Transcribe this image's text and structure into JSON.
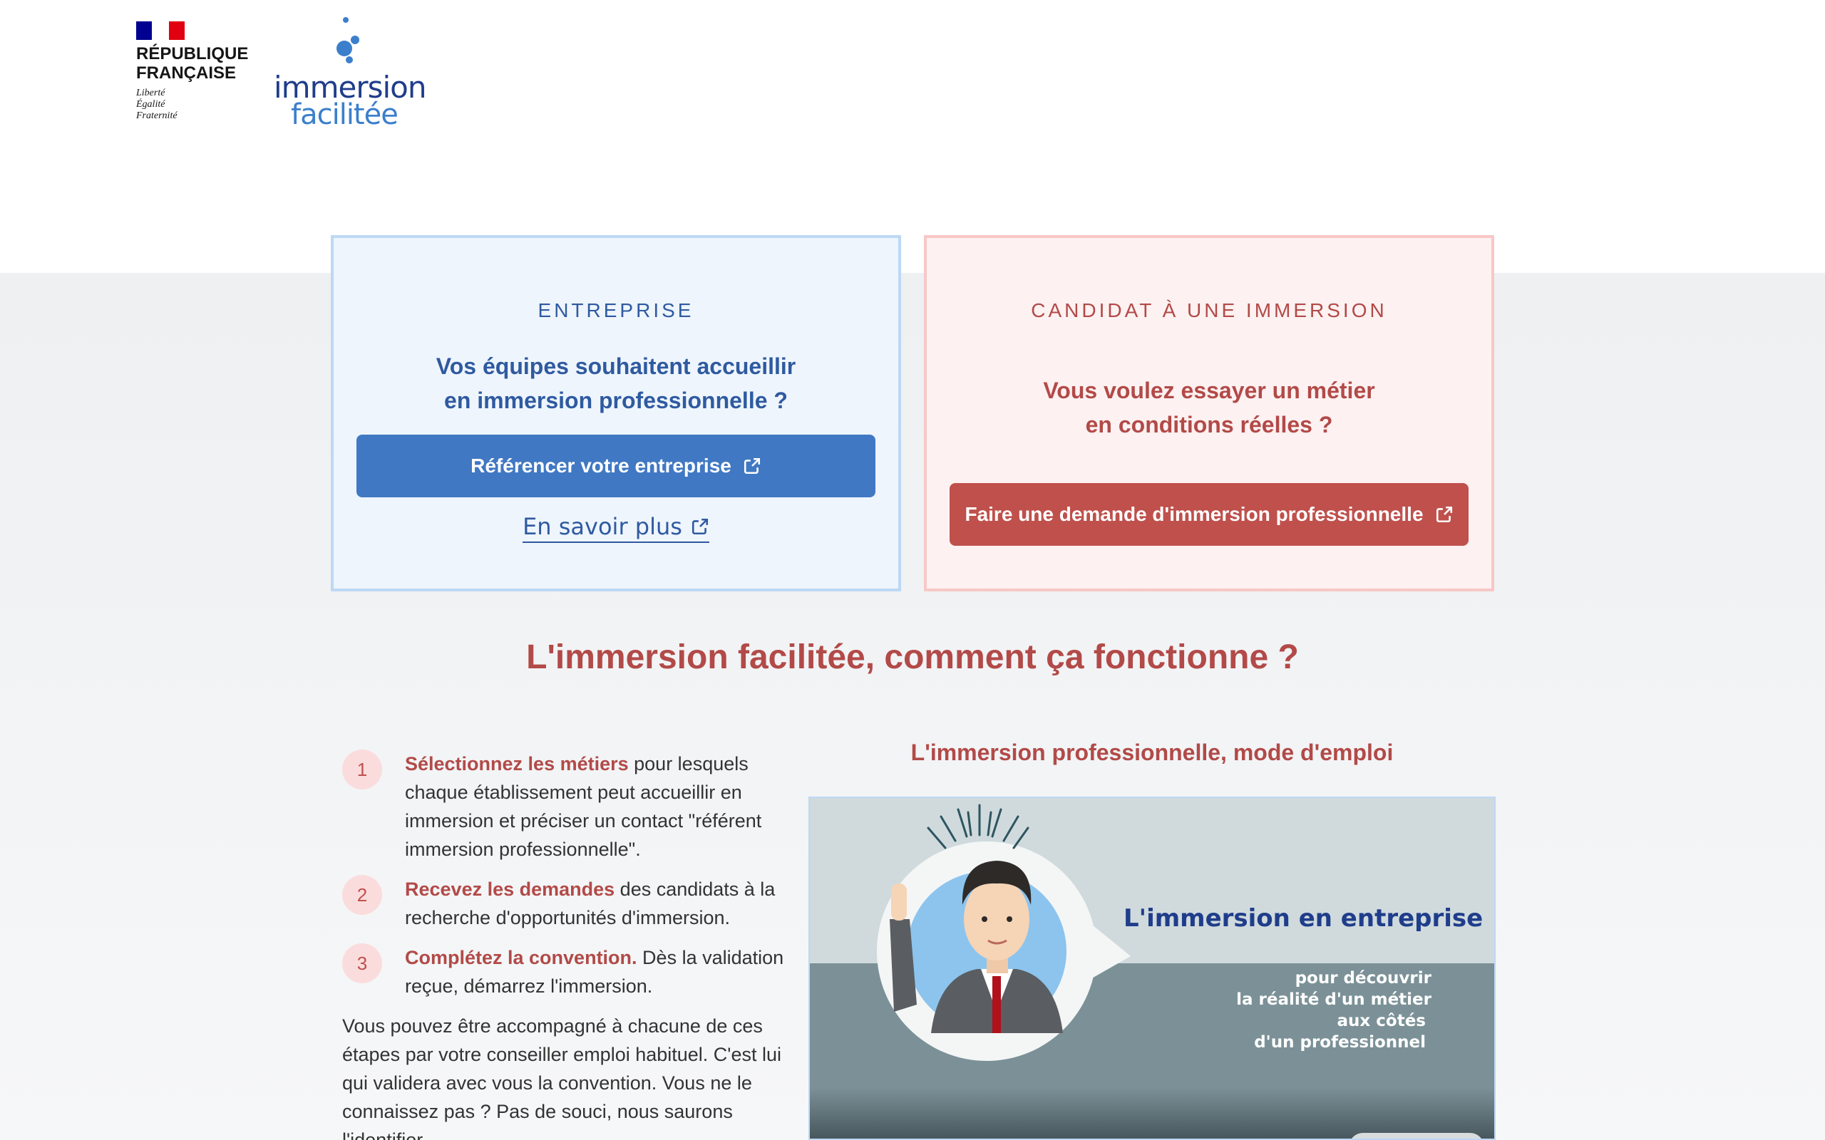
{
  "header": {
    "gov_line1": "RÉPUBLIQUE",
    "gov_line2": "FRANÇAISE",
    "motto1": "Liberté",
    "motto2": "Égalité",
    "motto3": "Fraternité",
    "logo_line1": "immersion",
    "logo_line2": "facilitée"
  },
  "cards": {
    "entreprise": {
      "kicker": "ENTREPRISE",
      "question_line1": "Vos équipes souhaitent accueillir",
      "question_line2": "en immersion professionnelle ?",
      "button": "Référencer votre entreprise",
      "link": "En savoir plus"
    },
    "candidat": {
      "kicker": "CANDIDAT À UNE IMMERSION",
      "question_line1": "Vous voulez essayer un métier",
      "question_line2": "en conditions réelles ?",
      "button": "Faire une demande d'immersion professionnelle"
    }
  },
  "how": {
    "title": "L'immersion facilitée, comment ça fonctionne ?",
    "steps": [
      {
        "num": "1",
        "bold": "Sélectionnez les métiers",
        "text": " pour lesquels chaque établissement peut accueillir en immersion et préciser un contact \"référent immersion professionnelle\"."
      },
      {
        "num": "2",
        "bold": "Recevez les demandes",
        "text": " des candidats à la recherche d'opportunités d'immersion."
      },
      {
        "num": "3",
        "bold": "Complétez la convention.",
        "text": " Dès la validation reçue, démarrez l'immersion."
      }
    ],
    "paragraph": "Vous pouvez être accompagné à chacune de ces étapes par votre conseiller emploi habituel. C'est lui qui validera avec vous la convention. Vous ne le connaissez pas ? Pas de souci, nous saurons l'identifier."
  },
  "video": {
    "title": "L'immersion professionnelle, mode d'emploi",
    "heading": "L'immersion en entreprise",
    "sub1": "pour découvrir",
    "sub2": "la réalité d'un métier",
    "sub3": "aux côtés",
    "sub4": "d'un professionnel"
  },
  "colors": {
    "blue": "#2f5aa0",
    "blue_button": "#4078c3",
    "red": "#b24a48",
    "red_button": "#bf504c"
  }
}
